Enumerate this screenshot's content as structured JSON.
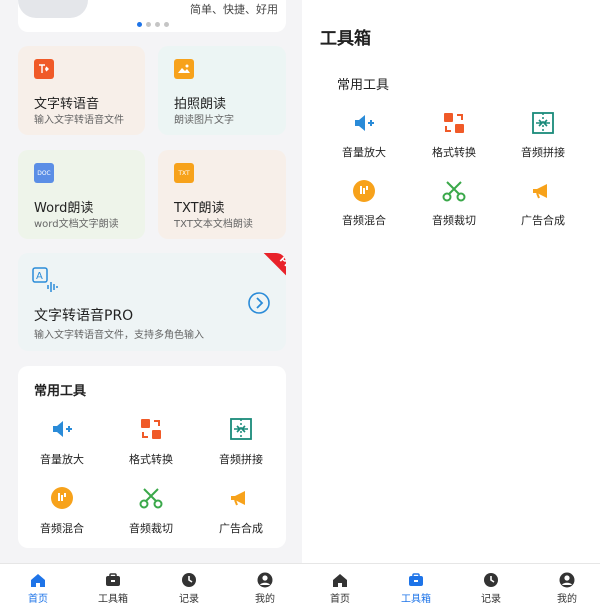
{
  "left": {
    "banner_text": "简单、快捷、好用",
    "cards": [
      {
        "title": "文字转语音",
        "subtitle": "输入文字转语音文件",
        "icon": "text-to-speech-icon"
      },
      {
        "title": "拍照朗读",
        "subtitle": "朗读图片文字",
        "icon": "photo-read-icon"
      },
      {
        "title": "Word朗读",
        "subtitle": "word文档文字朗读",
        "icon": "doc-icon",
        "icon_text": "DOC"
      },
      {
        "title": "TXT朗读",
        "subtitle": "TXT文本文档朗读",
        "icon": "txt-icon",
        "icon_text": "TXT"
      }
    ],
    "pro_card": {
      "title": "文字转语音PRO",
      "subtitle": "输入文字转语音文件，支持多角色输入",
      "ribbon": "PRO",
      "icon": "text-audio-icon"
    },
    "tools_title": "常用工具"
  },
  "right": {
    "title": "工具箱",
    "tools_title": "常用工具"
  },
  "tools": [
    {
      "label": "音量放大",
      "icon": "volume-up-icon"
    },
    {
      "label": "格式转换",
      "icon": "format-convert-icon"
    },
    {
      "label": "音频拼接",
      "icon": "audio-splice-icon"
    },
    {
      "label": "音频混合",
      "icon": "audio-mix-icon"
    },
    {
      "label": "音频裁切",
      "icon": "audio-cut-icon"
    },
    {
      "label": "广告合成",
      "icon": "ad-compose-icon"
    }
  ],
  "nav": [
    {
      "label": "首页",
      "icon": "home-icon"
    },
    {
      "label": "工具箱",
      "icon": "toolbox-icon"
    },
    {
      "label": "记录",
      "icon": "clock-icon"
    },
    {
      "label": "我的",
      "icon": "user-icon"
    }
  ],
  "colors": {
    "accent": "#1e74e8",
    "orange": "#f05a28",
    "teal": "#1a8a7a",
    "green": "#3aa84a",
    "amber": "#f7a21b"
  }
}
